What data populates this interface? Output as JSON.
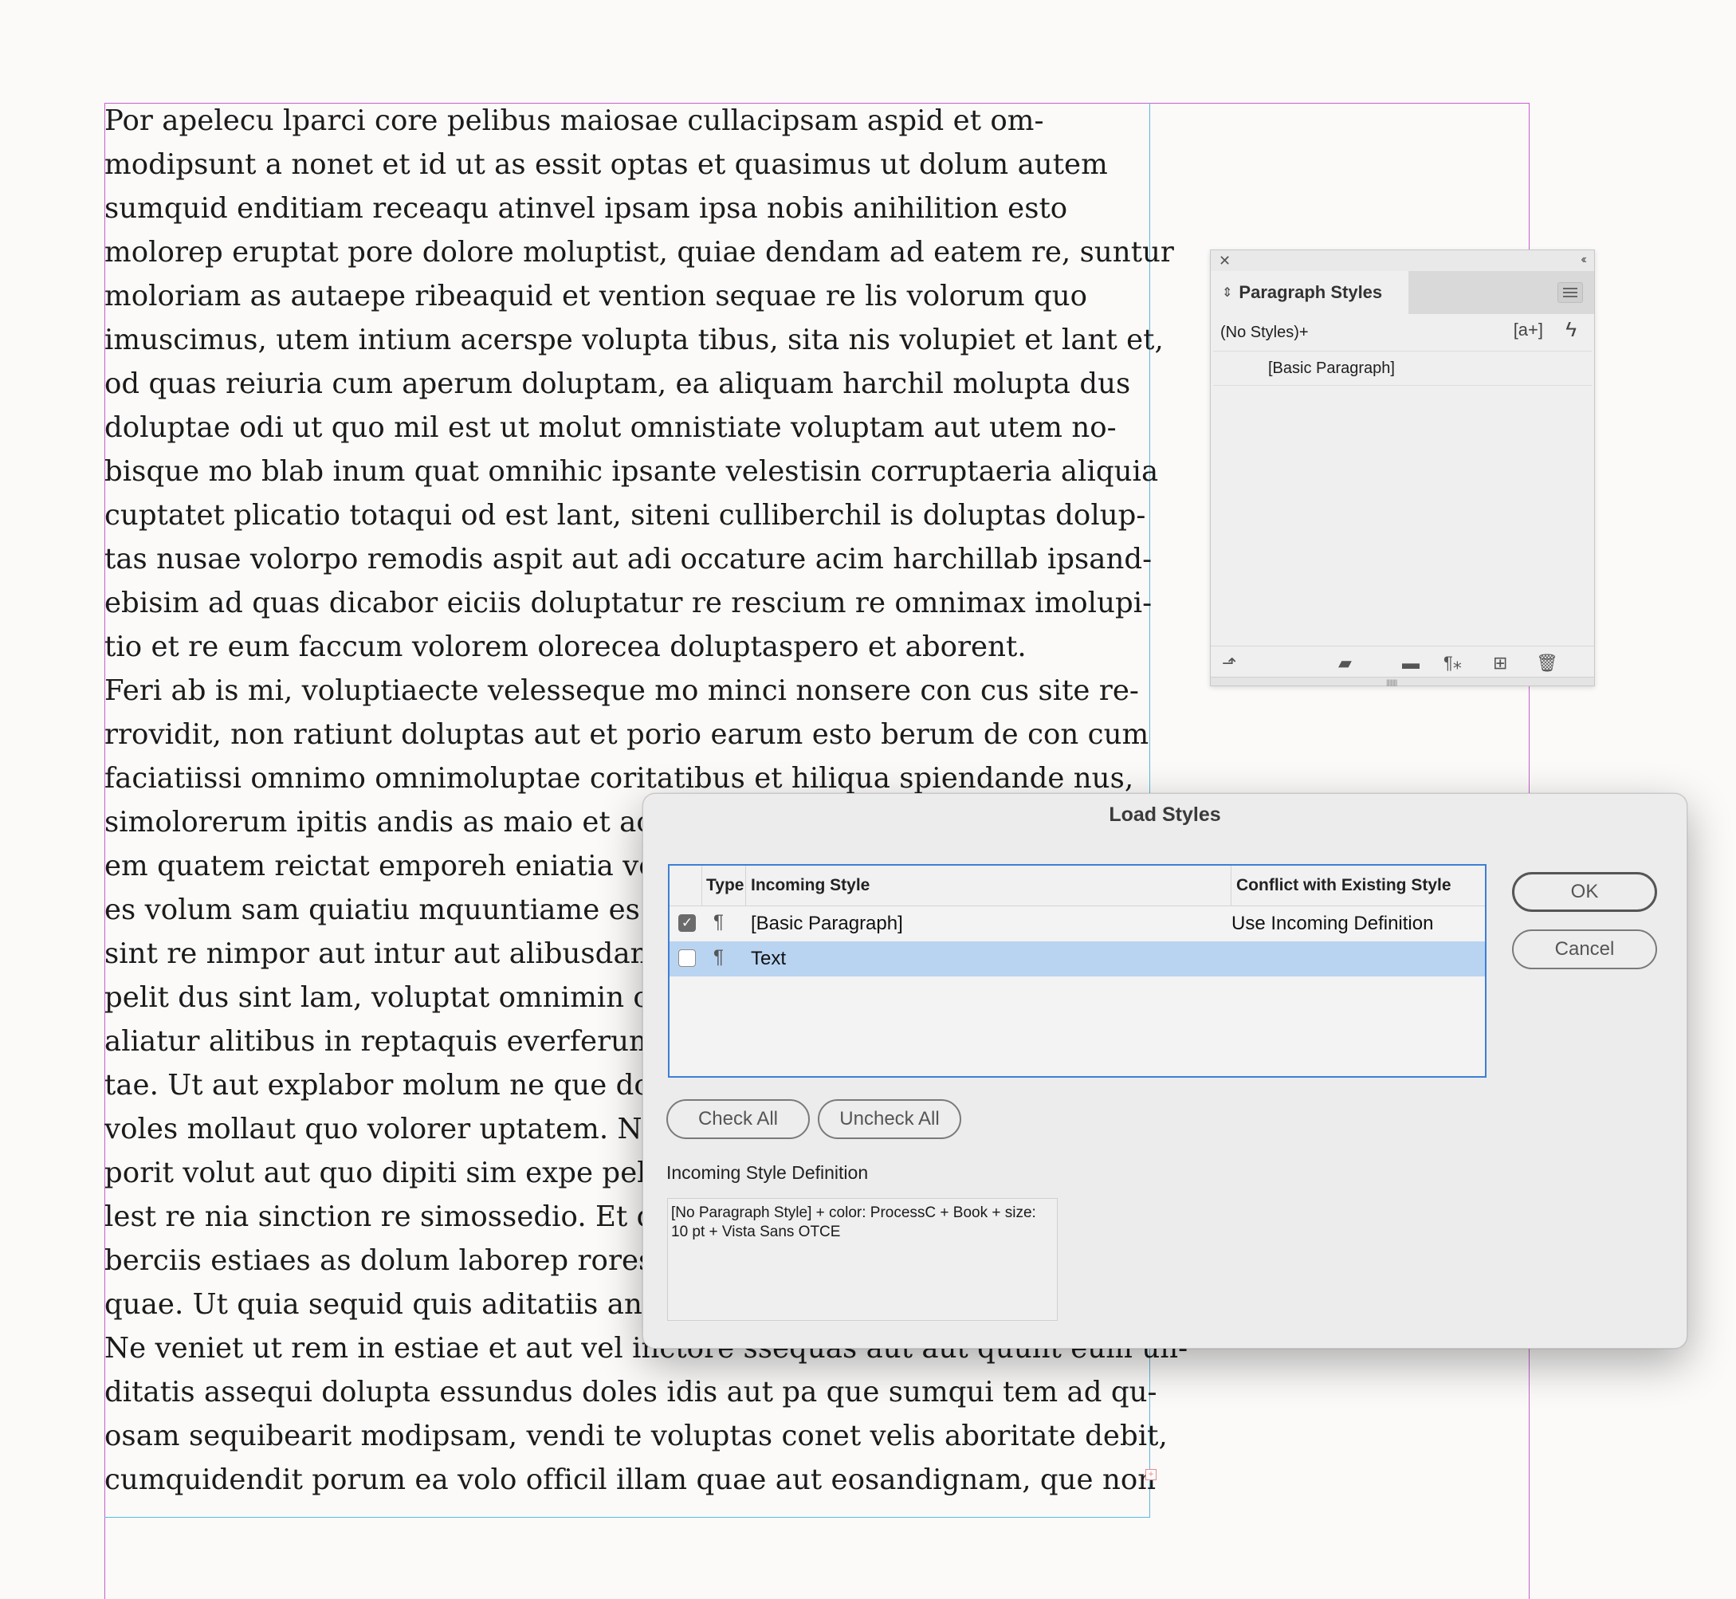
{
  "story": {
    "lines": [
      "Por apelecu lparci core pelibus maiosae cullacipsam aspid et om-",
      "modipsunt a nonet et id ut as essit optas et quasimus ut dolum autem",
      "sumquid enditiam receaqu atinvel ipsam ipsa nobis anihilition esto",
      "molorep eruptat pore dolore moluptist, quiae dendam ad eatem re, suntur",
      "moloriam as autaepe ribeaquid et vention sequae re lis volorum quo",
      "imuscimus, utem intium acerspe volupta tibus, sita nis volupiet et lant et,",
      "od quas reiuria cum aperum doluptam, ea aliquam harchil molupta dus",
      "doluptae odi ut quo mil est ut molut omnistiate voluptam aut utem no-",
      "bisque mo blab inum quat omnihic ipsante velestisin corruptaeria aliquia",
      "cuptatet plicatio totaqui od est lant, siteni culliberchil is doluptas dolup-",
      "tas nusae volorpo remodis aspit aut adi occature acim harchillab ipsand-",
      "ebisim ad quas dicabor eiciis doluptatur re rescium re omnimax imolupi-",
      "tio et re eum faccum volorem olorecea doluptaspero et aborent.",
      "Feri ab is mi, voluptiaecte velesseque mo minci nonsere con cus site re-",
      "rrovidit, non ratiunt doluptas aut et porio earum esto berum de con cum",
      "faciatiissi omnimo omnimoluptae coritatibus et hiliqua spiendande nus,",
      "simolorerum ipitis andis as maio et ac",
      "em quatem reictat emporeh eniatia ve",
      "es volum sam quiatiu mquuntiame es v",
      "sint re nimpor aut intur aut alibusdanc",
      "pelit dus sint lam, voluptat omnimin c",
      "aliatur alitibus in reptaquis everferum",
      "tae. Ut aut explabor molum ne que dol",
      "voles mollaut quo volorer uptatem. Ne",
      "porit volut aut quo dipiti sim expe pel i",
      "lest re nia sinction re simossedio. Et q",
      "berciis estiaes as dolum laborep roress",
      "quae. Ut quia sequid quis aditatiis and",
      "Ne veniet ut rem in estiae et aut vel inctore ssequas aut aut quunt eum un-",
      "ditatis assequi dolupta essundus doles idis aut pa que sumqui tem ad qu-",
      "osam sequibearit modipsam, vendi te voluptas conet velis aboritate debit,",
      "cumquidendit porum ea volo officil illam quae aut eosandignam, que non"
    ]
  },
  "panel": {
    "tab_label": "Paragraph Styles",
    "no_styles": "(No Styles)+",
    "new_style_glyph": "[a+]",
    "item": "[Basic Paragraph]",
    "icons": [
      "load-styles-icon",
      "folder-bolt-icon",
      "folder-icon",
      "clear-override-icon",
      "new-style-icon",
      "trash-icon"
    ]
  },
  "dialog": {
    "title": "Load Styles",
    "columns": {
      "type": "Type",
      "incoming": "Incoming Style",
      "conflict": "Conflict with Existing Style"
    },
    "rows": [
      {
        "checked": true,
        "type_glyph": "¶",
        "name": "[Basic Paragraph]",
        "conflict": "Use Incoming Definition",
        "selected": false
      },
      {
        "checked": false,
        "type_glyph": "¶",
        "name": "Text",
        "conflict": "",
        "selected": true
      }
    ],
    "ok_label": "OK",
    "cancel_label": "Cancel",
    "check_all_label": "Check All",
    "uncheck_all_label": "Uncheck All",
    "definition_label": "Incoming Style Definition",
    "definition_text": "[No Paragraph Style] + color: ProcessC + Book + size: 10 pt + Vista Sans OTCE"
  },
  "colors": {
    "margin_guide": "#c65fcf",
    "frame_edge": "#58b9df",
    "selection": "#b9d4f1",
    "focus": "#3c7fd6"
  }
}
